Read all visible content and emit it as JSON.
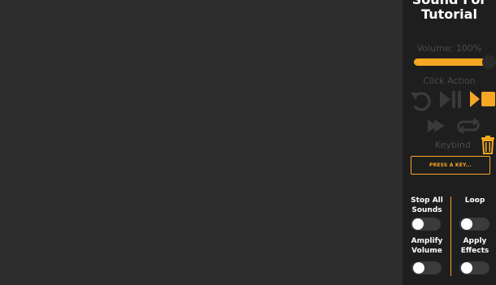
{
  "panel": {
    "title_line1": "Sound For",
    "title_line2": "Tutorial",
    "volume": {
      "label": "Volume: 100%",
      "value": 1.0,
      "fill_color": "#f5a623"
    },
    "click_action": {
      "label": "Click Action",
      "icons": [
        "undo-icon",
        "play-pause-icon",
        "play-stop-icon",
        "fast-forward-icon",
        "repeat-icon"
      ],
      "active_color": "#f5a623",
      "inactive_color": "#3a3a3a"
    },
    "keybind": {
      "label": "Keybind",
      "button_label": "PRESS A KEY..."
    },
    "delete_icon": "trash-icon",
    "options": {
      "stop_all": {
        "label_line1": "Stop All",
        "label_line2": "Sounds",
        "enabled": false
      },
      "loop": {
        "label_line1": "Loop",
        "enabled": false
      },
      "amplify": {
        "label_line1": "Amplify",
        "label_line2": "Volume",
        "enabled": false
      },
      "effects": {
        "label_line1": "Apply",
        "label_line2": "Effects",
        "enabled": false
      }
    }
  }
}
